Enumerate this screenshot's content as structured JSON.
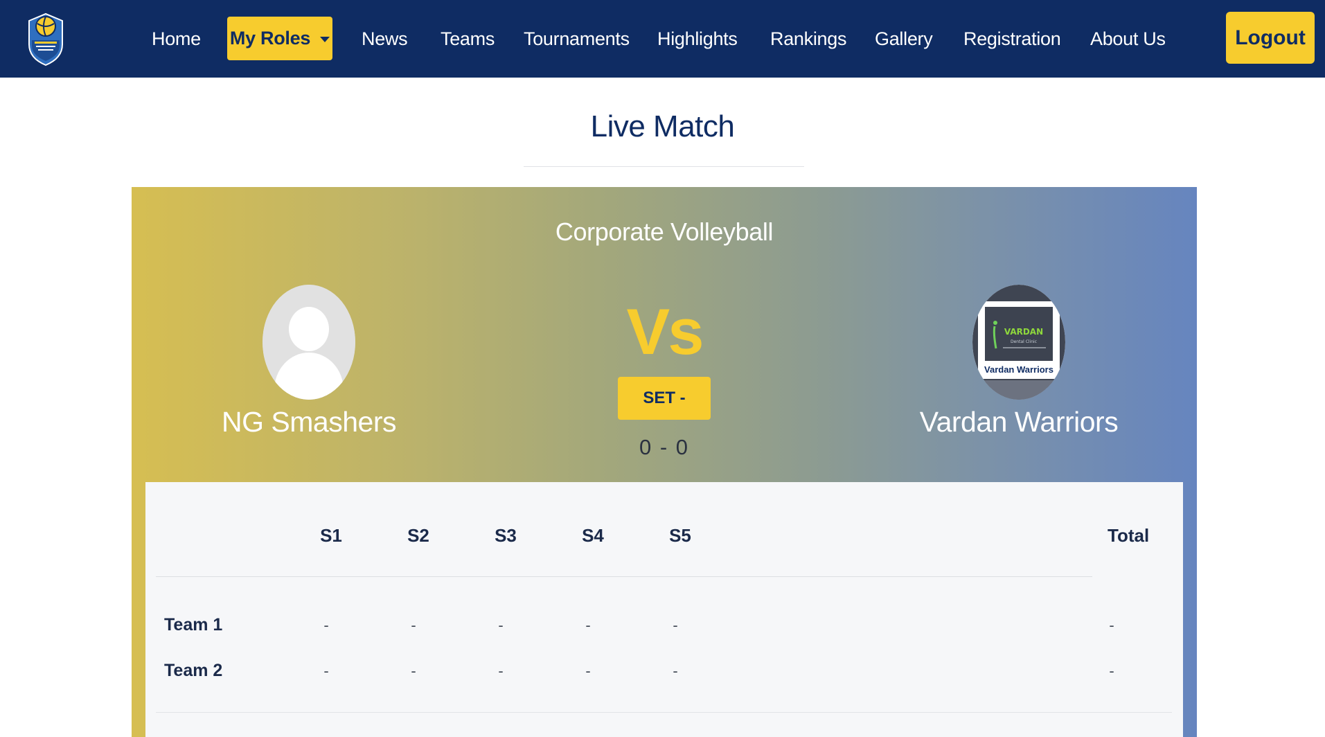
{
  "nav": {
    "logo_icon": "volleyball-shield-logo-icon",
    "items": [
      {
        "label": "Home"
      },
      {
        "label": "My Roles"
      },
      {
        "label": "News"
      },
      {
        "label": "Teams"
      },
      {
        "label": "Tournaments"
      },
      {
        "label": "Highlights"
      },
      {
        "label": "Rankings"
      },
      {
        "label": "Gallery"
      },
      {
        "label": "Registration"
      },
      {
        "label": "About Us"
      }
    ],
    "logout_label": "Logout"
  },
  "page": {
    "title": "Live Match"
  },
  "match": {
    "tournament": "Corporate Volleyball",
    "team1": {
      "name": "NG Smashers",
      "avatar_icon": "default-user-avatar-icon"
    },
    "team2": {
      "name": "Vardan Warriors",
      "logo_text": "VARDAN",
      "logo_subtext": "Dental Clinic",
      "logo_caption": "Vardan Warriors"
    },
    "vs_label": "Vs",
    "set_label": "SET -",
    "score": "0 - 0"
  },
  "scoreboard": {
    "headers": [
      "S1",
      "S2",
      "S3",
      "S4",
      "S5"
    ],
    "total_header": "Total",
    "rows": [
      {
        "label": "Team 1",
        "sets": [
          "-",
          "-",
          "-",
          "-",
          "-"
        ],
        "total": "-"
      },
      {
        "label": "Team 2",
        "sets": [
          "-",
          "-",
          "-",
          "-",
          "-"
        ],
        "total": "-"
      }
    ]
  },
  "colors": {
    "navbar": "#0f2c63",
    "accent": "#f7cc2e",
    "card_gradient_start": "#d6be52",
    "card_gradient_end": "#6685bf"
  }
}
